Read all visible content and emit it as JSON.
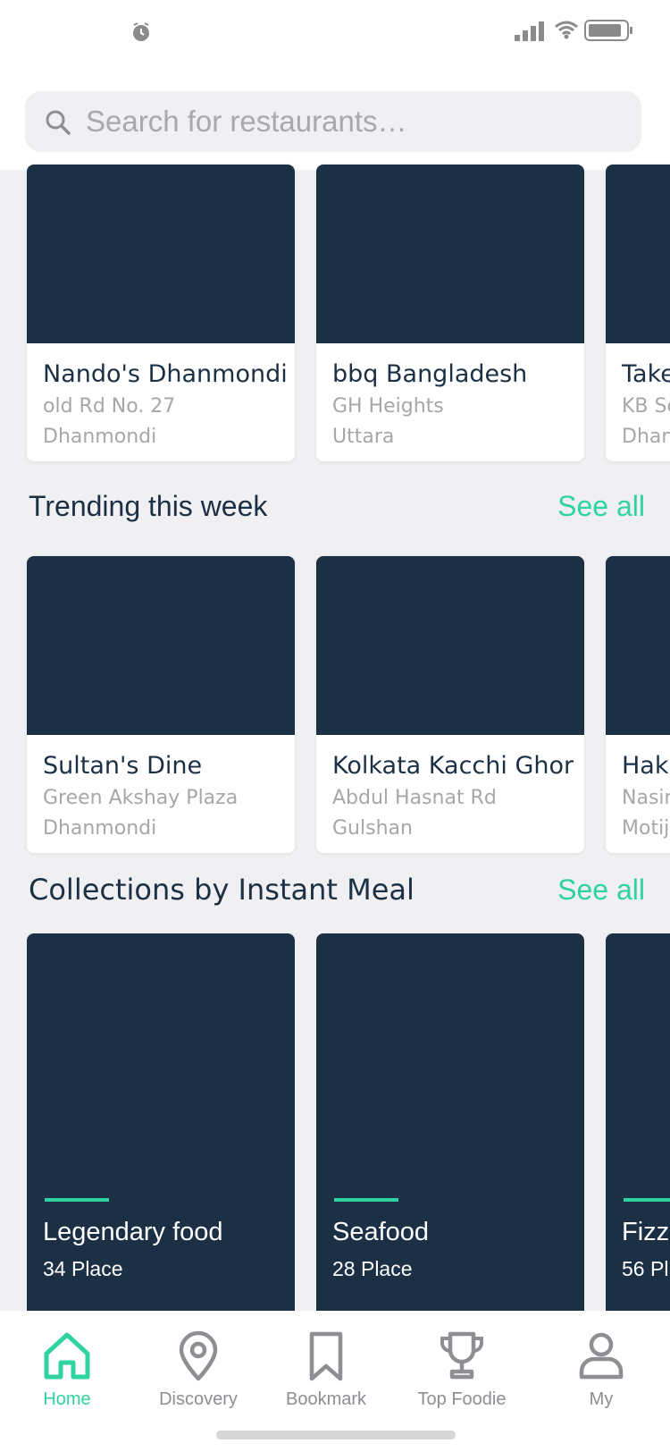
{
  "colors": {
    "accent": "#2fd3a0",
    "card_image": "#1b3044",
    "text_dark": "#1b3044",
    "text_muted": "#a7a7a7"
  },
  "search": {
    "placeholder": "Search for restaurants…"
  },
  "featured": {
    "cards": [
      {
        "name": "Nando's Dhanmondi",
        "address1": "old Rd No. 27",
        "address2": "Dhanmondi"
      },
      {
        "name": "bbq Bangladesh",
        "address1": "GH Heights",
        "address2": "Uttara"
      },
      {
        "name": "Take",
        "address1": "KB Sc",
        "address2": "Dhan"
      }
    ]
  },
  "trending": {
    "title": "Trending this week",
    "see_all": "See all",
    "cards": [
      {
        "name": "Sultan's Dine",
        "address1": "Green Akshay Plaza",
        "address2": "Dhanmondi"
      },
      {
        "name": "Kolkata Kacchi Ghor",
        "address1": "Abdul Hasnat Rd",
        "address2": "Gulshan"
      },
      {
        "name": "Hakl",
        "address1": "Nasir",
        "address2": "Motij"
      }
    ]
  },
  "collections": {
    "title": "Collections by Instant Meal",
    "see_all": "See all",
    "cards": [
      {
        "name": "Legendary food",
        "count": "34 Place"
      },
      {
        "name": "Seafood",
        "count": "28 Place"
      },
      {
        "name": "Fizza",
        "count": "56 Pl"
      }
    ]
  },
  "tabbar": {
    "items": [
      {
        "label": "Home",
        "icon": "home-icon",
        "active": true
      },
      {
        "label": "Discovery",
        "icon": "location-pin-icon",
        "active": false
      },
      {
        "label": "Bookmark",
        "icon": "bookmark-icon",
        "active": false
      },
      {
        "label": "Top Foodie",
        "icon": "trophy-icon",
        "active": false
      },
      {
        "label": "My",
        "icon": "person-icon",
        "active": false
      }
    ]
  }
}
